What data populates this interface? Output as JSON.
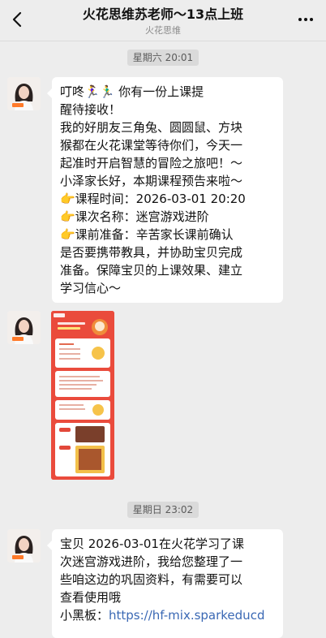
{
  "header": {
    "title": "火花思维苏老师～13点上班",
    "subtitle": "火花思维"
  },
  "timestamps": {
    "first": "星期六 20:01",
    "second": "星期日 23:02"
  },
  "message1": {
    "lines": [
      "叮咚🏃‍♀️🏃‍♂️ 你有一份上课提",
      "醒待接收！",
      "我的好朋友三角兔、圆圆鼠、方块",
      "猴都在火花课堂等待你们，今天一",
      "起准时开启智慧的冒险之旅吧！～",
      "小泽家长好，本期课程预告来啦～",
      "👉课程时间：2026-03-01 20:20",
      "👉课次名称：迷宫游戏进阶",
      "👉课前准备：辛苦家长课前确认",
      "是否要携带教具，并协助宝贝完成",
      "准备。保障宝贝的上课效果、建立",
      "学习信心～"
    ]
  },
  "message3": {
    "lines": [
      "宝贝 2026-03-01在火花学习了课",
      "次迷宫游戏进阶，我给您整理了一",
      "些咱这边的巩固资料，有需要可以",
      "查看使用哦"
    ],
    "link_prefix": "小黑板：",
    "link_text": "https://hf-mix.sparkeducd"
  },
  "colors": {
    "background": "#ededed",
    "bubble": "#ffffff",
    "link": "#3a68b4",
    "poster_red": "#ea4b3c"
  },
  "icons": {
    "back": "chevron-left-icon",
    "more": "more-dots-icon"
  }
}
